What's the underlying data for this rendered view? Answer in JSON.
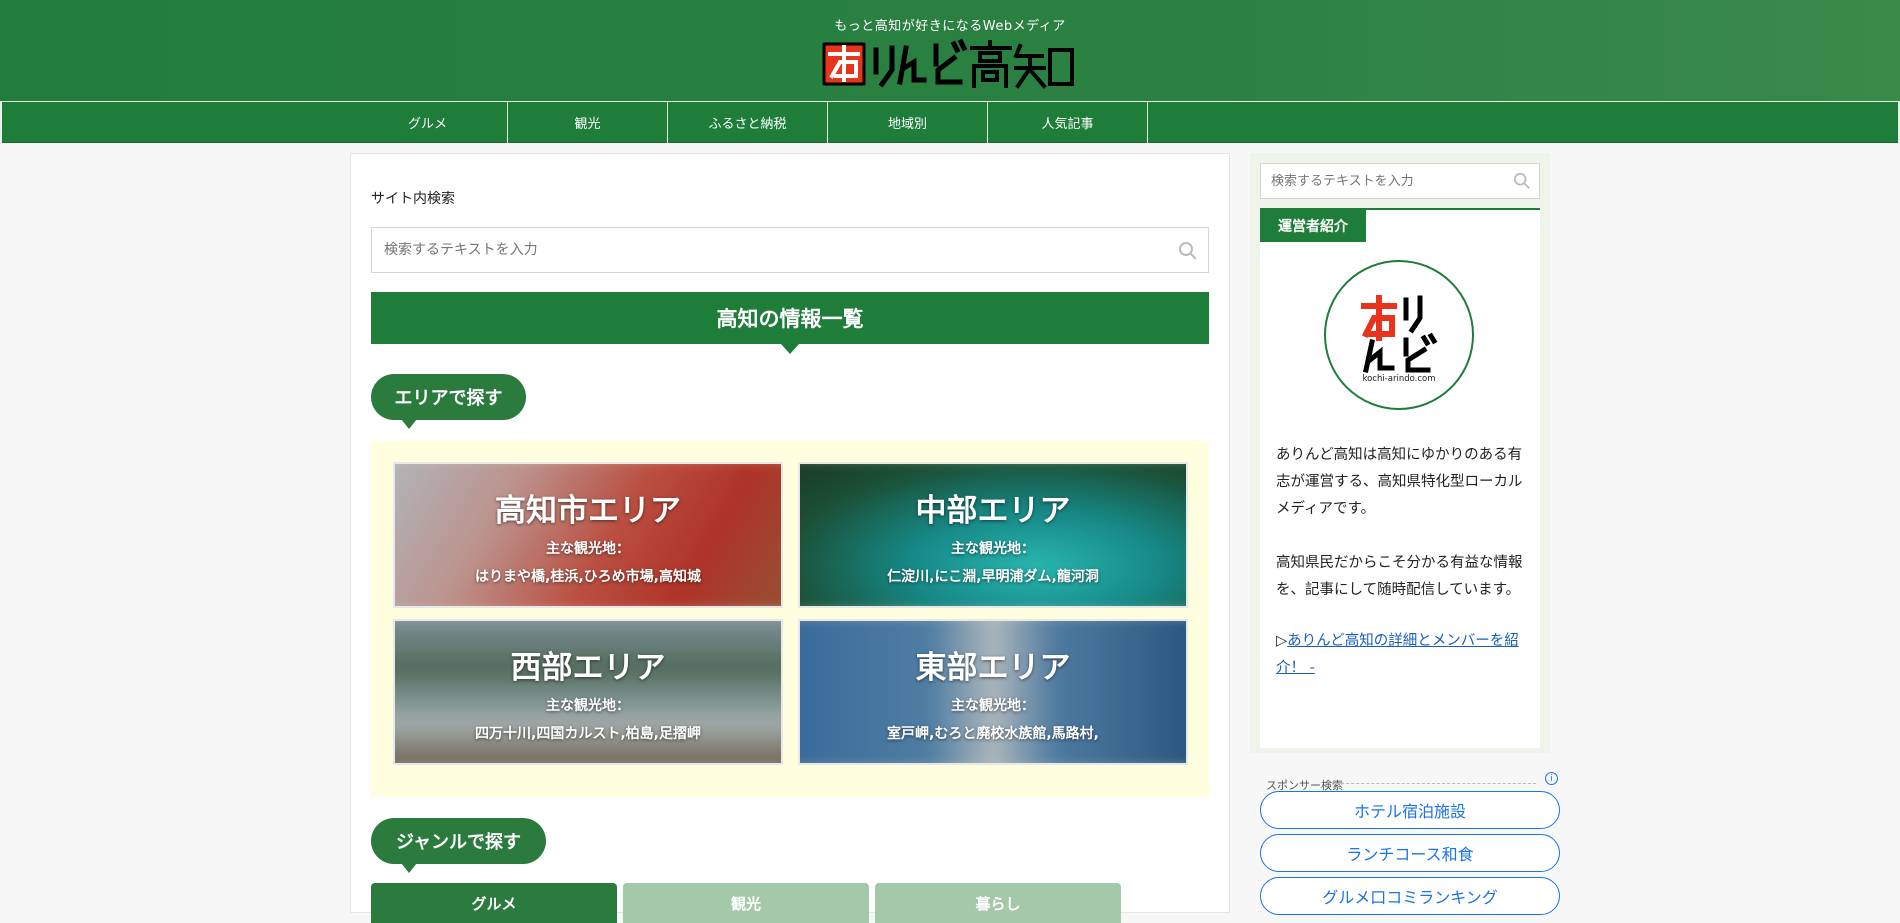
{
  "header": {
    "tagline": "もっと高知が好きになるWebメディア",
    "logo_text": "ありんど高知"
  },
  "nav": {
    "items": [
      {
        "label": "グルメ"
      },
      {
        "label": "観光"
      },
      {
        "label": "ふるさと納税"
      },
      {
        "label": "地域別"
      },
      {
        "label": "人気記事"
      }
    ]
  },
  "main": {
    "search_label": "サイト内検索",
    "search_placeholder": "検索するテキストを入力",
    "section_title": "高知の情報一覧",
    "area_heading": "エリアで探す",
    "areas": [
      {
        "title": "高知市エリア",
        "sub1": "主な観光地：",
        "sub2": "はりまや橋,桂浜,ひろめ市場,高知城"
      },
      {
        "title": "中部エリア",
        "sub1": "主な観光地：",
        "sub2": "仁淀川,にこ淵,早明浦ダム,龍河洞"
      },
      {
        "title": "西部エリア",
        "sub1": "主な観光地：",
        "sub2": "四万十川,四国カルスト,柏島,足摺岬"
      },
      {
        "title": "東部エリア",
        "sub1": "主な観光地：",
        "sub2": "室戸岬,むろと廃校水族館,馬路村,"
      }
    ],
    "genre_heading": "ジャンルで探す",
    "genre_tabs": [
      {
        "label": "グルメ"
      },
      {
        "label": "観光"
      },
      {
        "label": "暮らし"
      }
    ]
  },
  "sidebar": {
    "search_placeholder": "検索するテキストを入力",
    "widget_title": "運営者紹介",
    "avatar_caption": "kochi-arindo.com",
    "profile_p1": "ありんど高知は高知にゆかりのある有志が運営する、高知県特化型ローカルメディアです。",
    "profile_p2": "高知県民だからこそ分かる有益な情報を、記事にして随時配信しています。",
    "profile_link_prefix": "▷",
    "profile_link": "ありんど高知の詳細とメンバーを紹介！ -",
    "sponsor_label": "スポンサー検索",
    "sponsor_buttons": [
      {
        "label": "ホテル宿泊施設"
      },
      {
        "label": "ランチコース和食"
      },
      {
        "label": "グルメ口コミランキング"
      }
    ]
  },
  "colors": {
    "brand_green": "#1f7d3a",
    "area_bg": "#ffffdf",
    "link_blue": "#1a5fbf",
    "sponsor_blue": "#1a73e8"
  }
}
